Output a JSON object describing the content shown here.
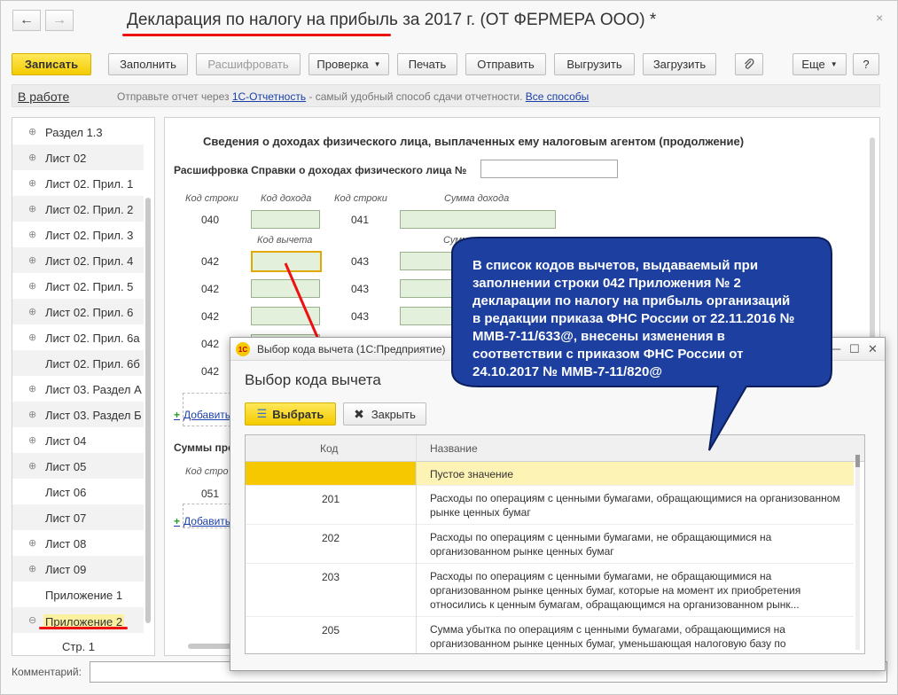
{
  "window": {
    "title": "Декларация по налогу на прибыль за 2017 г. (ОТ ФЕРМЕРА ООО) *",
    "back_icon": "arrow-left",
    "forward_icon": "arrow-right",
    "close_glyph": "×"
  },
  "toolbar": {
    "save": "Записать",
    "fill": "Заполнить",
    "decode": "Расшифровать",
    "check": "Проверка",
    "print": "Печать",
    "send": "Отправить",
    "upload": "Выгрузить",
    "load": "Загрузить",
    "attach_icon": "paperclip",
    "more": "Еще",
    "help": "?"
  },
  "status": {
    "state": "В работе",
    "text_before": "Отправьте отчет через ",
    "link1": "1С-Отчетность",
    "text_middle": " - самый удобный способ сдачи отчетности. ",
    "link2": "Все способы"
  },
  "tree": {
    "items": [
      {
        "label": "Раздел 1.3",
        "exp": "⊕"
      },
      {
        "label": "Лист 02",
        "exp": "⊕"
      },
      {
        "label": "Лист 02. Прил. 1",
        "exp": "⊕"
      },
      {
        "label": "Лист 02. Прил. 2",
        "exp": "⊕"
      },
      {
        "label": "Лист 02. Прил. 3",
        "exp": "⊕"
      },
      {
        "label": "Лист 02. Прил. 4",
        "exp": "⊕"
      },
      {
        "label": "Лист 02. Прил. 5",
        "exp": "⊕"
      },
      {
        "label": "Лист 02. Прил. 6",
        "exp": "⊕"
      },
      {
        "label": "Лист 02. Прил. 6а",
        "exp": "⊕"
      },
      {
        "label": "Лист 02. Прил. 6б",
        "exp": ""
      },
      {
        "label": "Лист 03. Раздел А",
        "exp": "⊕"
      },
      {
        "label": "Лист 03. Раздел Б",
        "exp": "⊕"
      },
      {
        "label": "Лист 04",
        "exp": "⊕"
      },
      {
        "label": "Лист 05",
        "exp": "⊕"
      },
      {
        "label": "Лист 06",
        "exp": ""
      },
      {
        "label": "Лист 07",
        "exp": ""
      },
      {
        "label": "Лист 08",
        "exp": "⊕"
      },
      {
        "label": "Лист 09",
        "exp": "⊕"
      },
      {
        "label": "Приложение 1",
        "exp": ""
      },
      {
        "label": "Приложение 2",
        "exp": "⊖"
      },
      {
        "label": "Стр. 1",
        "exp": ""
      }
    ]
  },
  "form": {
    "title": "Сведения о доходах физического лица, выплаченных ему налоговым агентом (продолжение)",
    "ref_label": "Расшифровка Справки о доходах физического лица №",
    "col_code_line": "Код строки",
    "col_income_code": "Код дохода",
    "col_code_line2": "Код строки",
    "col_income_sum": "Сумма дохода",
    "deduction_code": "Код вычета",
    "deduction_sum": "Сумма вычета",
    "rows_left": [
      "040",
      "042",
      "042",
      "042",
      "042",
      "042"
    ],
    "rows_right": [
      "041",
      "043",
      "043",
      "043"
    ],
    "add_link": "Добавить",
    "sums_label": "Суммы пре",
    "code_line3": "Код стро",
    "row_051": "051",
    "add_link2": "Добавить"
  },
  "comment": {
    "label": "Комментарий:"
  },
  "dialog": {
    "window_title": "Выбор кода вычета  (1С:Предприятие)",
    "logo": "1С",
    "heading": "Выбор кода вычета",
    "select_button": "Выбрать",
    "close_button": "Закрыть",
    "col_code": "Код",
    "col_name": "Название",
    "rows": [
      {
        "code": "",
        "name": "Пустое значение"
      },
      {
        "code": "201",
        "name": "Расходы по операциям с ценными бумагами, обращающимися на организованном рынке ценных бумаг"
      },
      {
        "code": "202",
        "name": "Расходы по операциям с ценными бумагами, не обращающимися на организованном рынке ценных бумаг"
      },
      {
        "code": "203",
        "name": "Расходы по операциям с ценными бумагами, не обращающимися на организованном рынке ценных бумаг, которые на момент их приобретения относились к ценным бумагам, обращающимся на организованном рынк..."
      },
      {
        "code": "205",
        "name": "Сумма убытка по операциям с ценными бумагами, обращающимися на организованном рынке ценных бумаг, уменьшающая налоговую базу по"
      }
    ]
  },
  "callout": {
    "text": "В список кодов вычетов, выдаваемый при заполнении строки 042 Приложения № 2 декларации по налогу на прибыль организаций в редакции приказа ФНС России от 22.11.2016 № ММВ-7-11/633@, внесены изменения в соответствии с приказом ФНС России от 24.10.2017 № ММВ-7-11/820@",
    "fill": "#1c3fa0"
  }
}
